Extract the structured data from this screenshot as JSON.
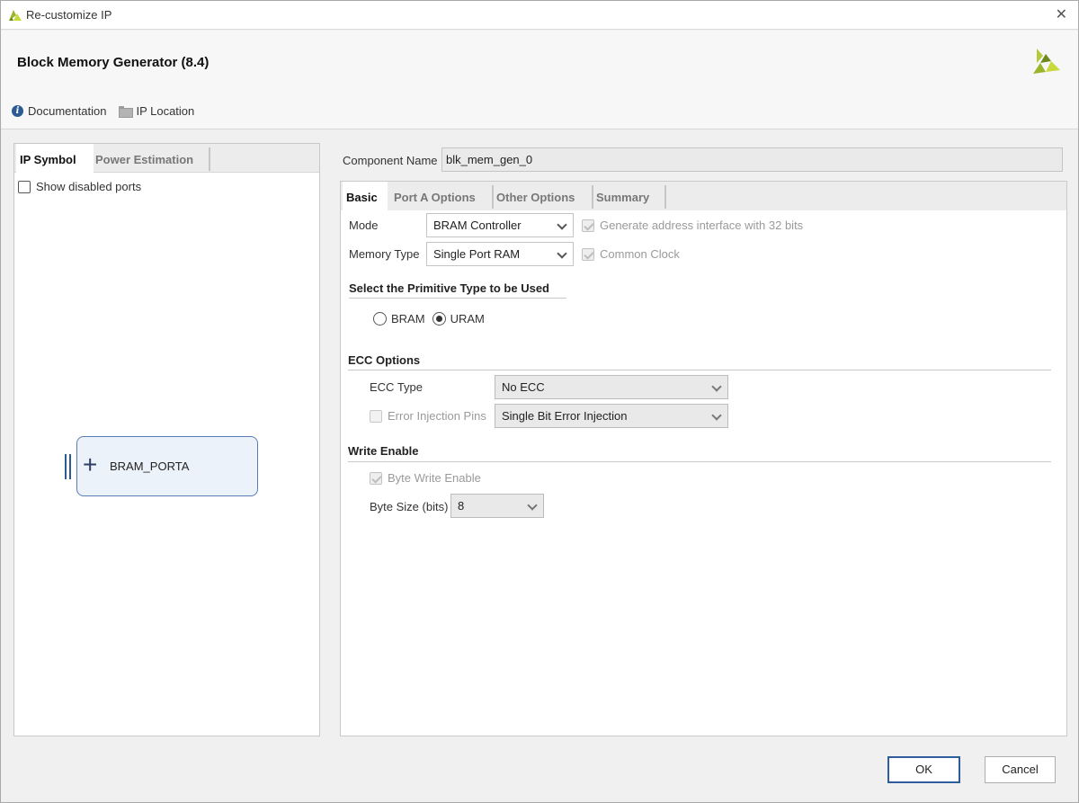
{
  "window": {
    "title": "Re-customize IP",
    "close_glyph": "✕"
  },
  "header": {
    "heading": "Block Memory Generator (8.4)",
    "links": {
      "documentation": "Documentation",
      "ip_location": "IP Location"
    }
  },
  "left_panel": {
    "tabs": [
      "IP Symbol",
      "Power Estimation"
    ],
    "active_tab": "IP Symbol",
    "show_disabled_ports": {
      "label": "Show disabled ports",
      "checked": false
    },
    "symbol": {
      "port_label": "BRAM_PORTA",
      "expand_glyph": "+"
    }
  },
  "component": {
    "label": "Component Name",
    "value": "blk_mem_gen_0"
  },
  "right_panel": {
    "tabs": [
      "Basic",
      "Port A Options",
      "Other Options",
      "Summary"
    ],
    "active_tab": "Basic",
    "mode": {
      "label": "Mode",
      "value": "BRAM Controller"
    },
    "memory_type": {
      "label": "Memory Type",
      "value": "Single Port RAM"
    },
    "gen_address": {
      "label": "Generate address interface with 32 bits",
      "checked": true,
      "enabled": false
    },
    "common_clock": {
      "label": "Common Clock",
      "checked": true,
      "enabled": false
    },
    "primitive": {
      "title": "Select the Primitive Type to be Used",
      "options": [
        "BRAM",
        "URAM"
      ],
      "selected": "URAM"
    },
    "ecc": {
      "title": "ECC Options",
      "type_label": "ECC Type",
      "type_value": "No ECC",
      "error_injection_label": "Error Injection Pins",
      "error_injection_checked": false,
      "error_injection_value": "Single Bit Error Injection"
    },
    "write_enable": {
      "title": "Write Enable",
      "byte_write_label": "Byte Write Enable",
      "byte_write_checked": true,
      "byte_size_label": "Byte Size (bits)",
      "byte_size_value": "8"
    }
  },
  "footer": {
    "ok": "OK",
    "cancel": "Cancel"
  },
  "colors": {
    "accent": "#2d5d9f",
    "brand": "#9bb52a"
  }
}
